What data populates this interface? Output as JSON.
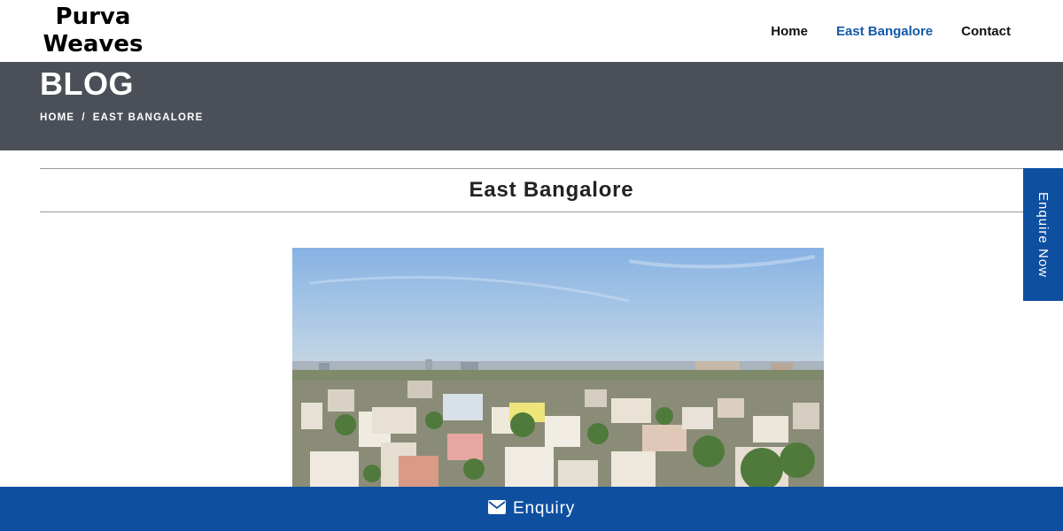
{
  "logo": {
    "line1": "Purva",
    "line2": "Weaves"
  },
  "nav": {
    "items": [
      {
        "label": "Home",
        "active": false
      },
      {
        "label": "East Bangalore",
        "active": true
      },
      {
        "label": "Contact",
        "active": false
      }
    ]
  },
  "banner": {
    "title": "BLOG",
    "breadcrumb": {
      "home": "HOME",
      "separator": "/",
      "current": "EAST BANGALORE"
    }
  },
  "section": {
    "title": "East Bangalore"
  },
  "side_tab": {
    "label": "Enquire Now"
  },
  "bottom_bar": {
    "icon": "envelope-icon",
    "label": "Enquiry"
  },
  "colors": {
    "accent": "#0e4fa0",
    "nav_active": "#1559a8",
    "banner_bg": "#4b5058"
  }
}
